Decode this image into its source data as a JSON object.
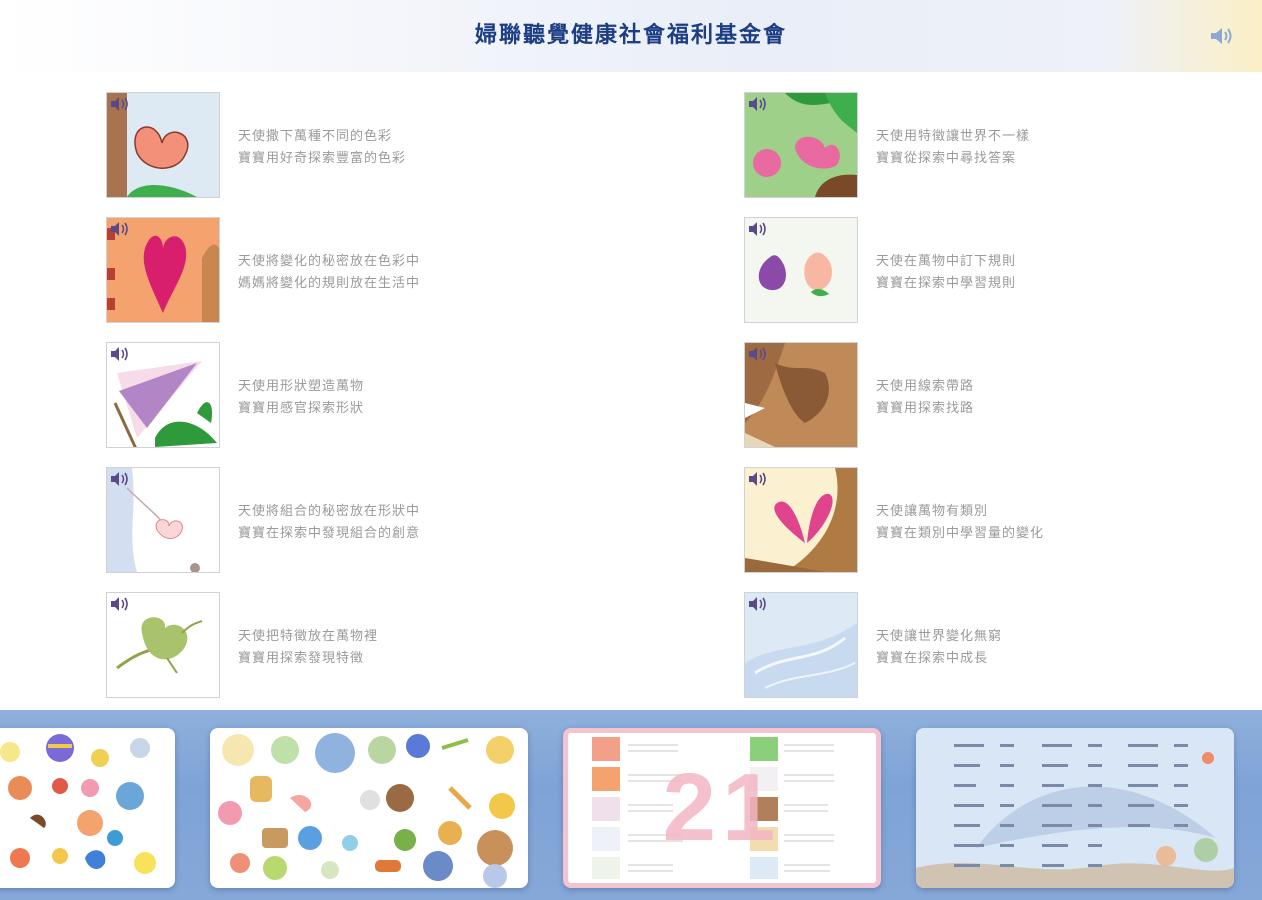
{
  "header": {
    "title": "婦聯聽覺健康社會福利基金會",
    "speaker_icon": "speaker-icon"
  },
  "items": [
    {
      "line1": "天使撒下萬種不同的色彩",
      "line2": "寶寶用好奇探索豐富的色彩"
    },
    {
      "line1": "天使用特徵讓世界不一樣",
      "line2": "寶寶從探索中尋找答案"
    },
    {
      "line1": "天使將變化的秘密放在色彩中",
      "line2": "媽媽將變化的規則放在生活中"
    },
    {
      "line1": "天使在萬物中訂下規則",
      "line2": "寶寶在探索中學習規則"
    },
    {
      "line1": "天使用形狀塑造萬物",
      "line2": "寶寶用感官探索形狀"
    },
    {
      "line1": "天使用線索帶路",
      "line2": "寶寶用探索找路"
    },
    {
      "line1": "天使將組合的秘密放在形狀中",
      "line2": "寶寶在探索中發現組合的創意"
    },
    {
      "line1": "天使讓萬物有類別",
      "line2": "寶寶在類別中學習量的變化"
    },
    {
      "line1": "天使把特徵放在萬物裡",
      "line2": "寶寶用探索發現特徵"
    },
    {
      "line1": "天使讓世界變化無窮",
      "line2": "寶寶在探索中成長"
    }
  ],
  "pages": {
    "current_page_number": "21"
  },
  "colors": {
    "title": "#1d3e84",
    "caption": "#9a9a9a",
    "strip": "#7ea3d6",
    "active_page_border": "#f3c3cf"
  }
}
